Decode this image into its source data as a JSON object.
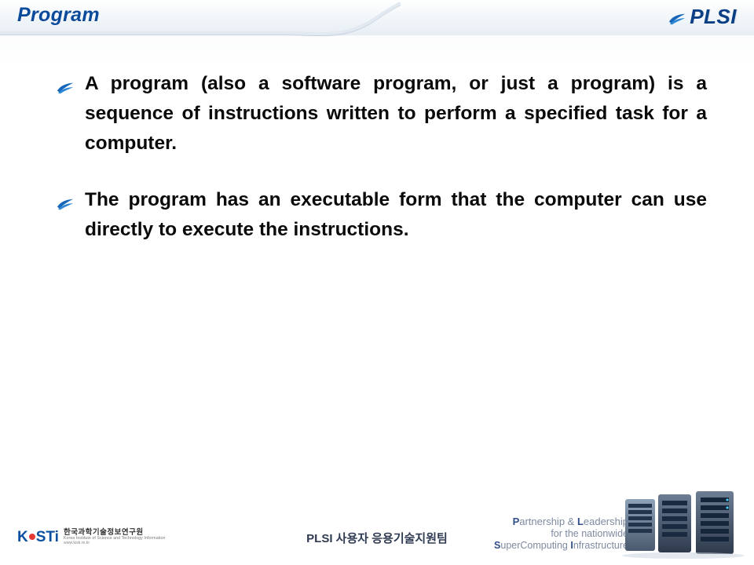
{
  "header": {
    "title": "Program",
    "brand": "PLSI"
  },
  "bullets": [
    "A program (also a software program, or just a program) is a sequence of instructions written to perform a specified task for a computer.",
    "The program has an executable form that the computer can use directly to execute the instructions."
  ],
  "footer": {
    "kisti_logo_text": "KiSTi",
    "kisti_kr": "한국과학기술정보연구원",
    "kisti_en": "Korea Institute of Science and Technology Information",
    "kisti_url": "www.kisti.re.kr",
    "center": "PLSI 사용자 응용기술지원팀",
    "tagline_line1_pre": "P",
    "tagline_line1_word1": "artnership & ",
    "tagline_line1_pre2": "L",
    "tagline_line1_word2": "eadership",
    "tagline_line2": "for the nationwide",
    "tagline_line3_pre": "S",
    "tagline_line3_word1": "uperComputing ",
    "tagline_line3_pre2": "I",
    "tagline_line3_word2": "nfrastructure"
  },
  "colors": {
    "title": "#0b4a9a",
    "brand": "#0a3f86",
    "body": "#0a0a0a"
  }
}
